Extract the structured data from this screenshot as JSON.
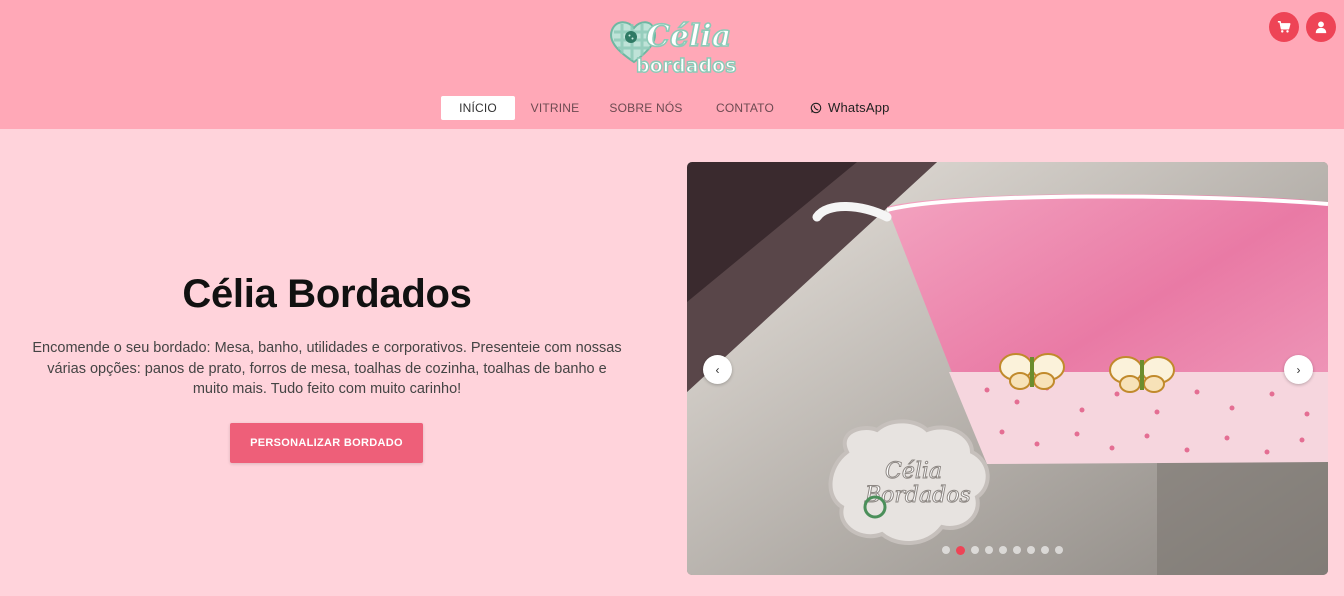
{
  "brand": {
    "logo_text_top": "Célia",
    "logo_text_bottom": "bordados"
  },
  "header": {
    "cart_icon": "cart-icon",
    "user_icon": "user-icon"
  },
  "nav": {
    "items": [
      {
        "label": "Início"
      },
      {
        "label": "Vitrine"
      },
      {
        "label": "Sobre nós"
      },
      {
        "label": "Contato"
      },
      {
        "label": "WhatsApp",
        "icon": "whatsapp-icon"
      }
    ]
  },
  "hero": {
    "title": "Célia Bordados",
    "description": "Encomende o seu bordado: Mesa, banho, utilidades e corporativos. Presenteie com nossas várias opções: panos de prato, forros de mesa, toalhas de cozinha, toalhas de banho e muito mais. Tudo feito com muito carinho!",
    "cta_label": "Personalizar Bordado"
  },
  "carousel": {
    "prev_label": "‹",
    "next_label": "›",
    "slide_count": 9,
    "active_slide": 2,
    "photo_tag_line1": "Célia",
    "photo_tag_line2": "Bordados"
  },
  "colors": {
    "header_bg": "#ffa8b7",
    "page_bg": "#ffd3db",
    "accent": "#ee4456",
    "cta_bg": "#ee5f79"
  }
}
